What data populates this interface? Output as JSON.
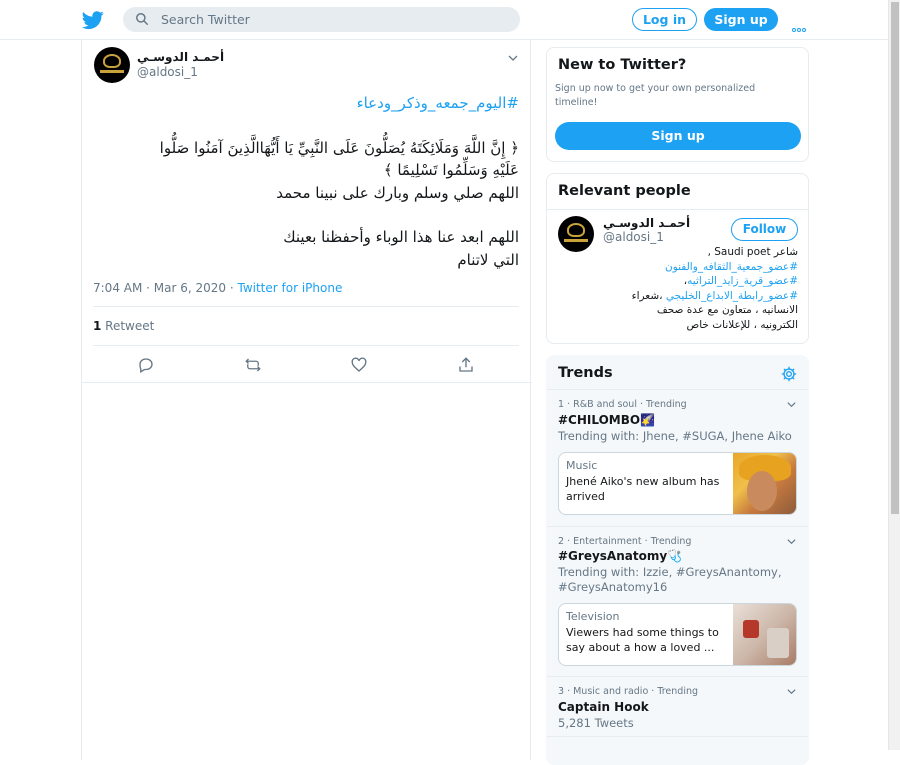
{
  "header": {
    "search_placeholder": "Search Twitter",
    "login_label": "Log in",
    "signup_label": "Sign up"
  },
  "tweet": {
    "author_name": "أحمـد الدوسـي",
    "author_handle": "@aldosi_1",
    "hashtag": "#اليوم_جمعه_وذكر_ودعاء",
    "line1": "﴿ إِنَّ اللَّهَ وَمَلَائِكَتَهُ يُصَلُّونَ عَلَى النَّبِيِّ يَا أَيُّهَاالَّذِينَ آمَنُوا صَلُّوا",
    "line2": "عَلَيْهِ وَسَلِّمُوا تَسْلِيمًا ﴾",
    "line3": "اللهم صلي وسلم وبارك على نبينا محمد",
    "line4": "اللهم ابعد عنا هذا الوباء وأحفظنا بعينك",
    "line5": "التي لاتنام",
    "time": "7:04 AM · Mar 6, 2020 · ",
    "source": "Twitter for iPhone",
    "retweet_count": "1",
    "retweet_label": " Retweet"
  },
  "new_to_twitter": {
    "title": "New to Twitter?",
    "description": "Sign up now to get your own personalized timeline!",
    "signup_label": "Sign up"
  },
  "relevant_people": {
    "title": "Relevant people",
    "name": "أحمـد الدوسـي",
    "handle": "@aldosi_1",
    "follow_label": "Follow",
    "bio_line1": "شاعر Saudi poet ,",
    "bio_tag1": "#عضو_جمعية_الثقافه_والفنون",
    "bio_tag2": "#عضو_قرية_زايد_التراثيه",
    "bio_tag2_suffix": "،",
    "bio_tag3": "#عضو_رابطة_الابداع_الخليجي",
    "bio_line4_suffix": " ،شعراء",
    "bio_line5": "الانسانيه ، متعاون مع عدة صحف",
    "bio_line6": "الكترونيه ، للإعلانات خاص"
  },
  "trends": {
    "title": "Trends",
    "items": [
      {
        "meta": "1 · R&B and soul · Trending",
        "name": "#CHILOMBO🌠",
        "with": "Trending with: Jhene, #SUGA, Jhene Aiko",
        "media_category": "Music",
        "media_headline": "Jhené Aiko's new album has arrived"
      },
      {
        "meta": "2 · Entertainment · Trending",
        "name": "#GreysAnatomy🩺",
        "with": "Trending with: Izzie, #GreysAnantomy, #GreysAnatomy16",
        "media_category": "Television",
        "media_headline": "Viewers had some things to say about a how a loved ..."
      },
      {
        "meta": "3 · Music and radio · Trending",
        "name": "Captain Hook",
        "with": "5,281 Tweets"
      }
    ]
  },
  "colors": {
    "accent": "#1da1f2",
    "muted": "#657786",
    "text": "#14171a",
    "border": "#e6ecf0"
  }
}
